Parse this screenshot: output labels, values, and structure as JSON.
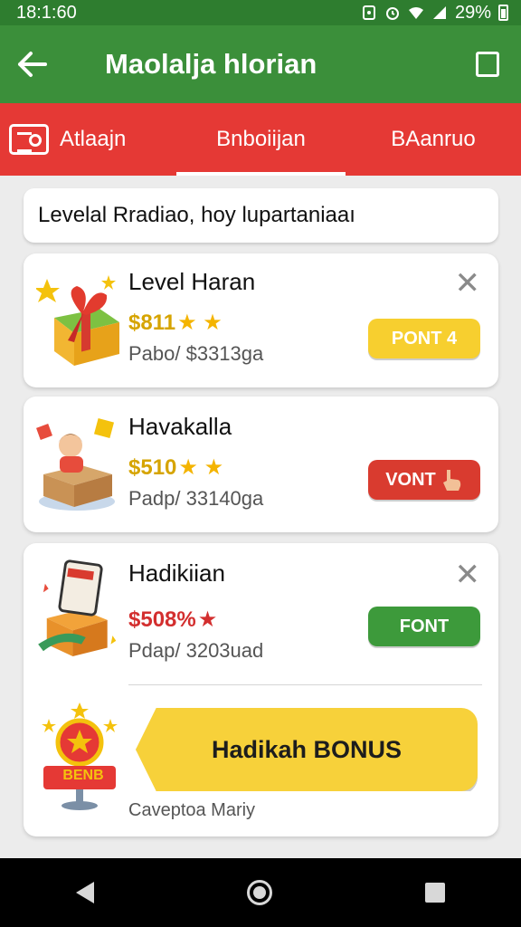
{
  "status_bar": {
    "time": "18:1:60",
    "battery": "29%"
  },
  "app_bar": {
    "title": "Maolalja hlorian",
    "back_icon": "arrow-left-icon",
    "action_icon": "square-icon"
  },
  "tabs": [
    {
      "label": "Atlaajn",
      "icon": "grid-icon",
      "active": false
    },
    {
      "label": "Bnboiijan",
      "active": true
    },
    {
      "label": "BAanruo",
      "active": false
    }
  ],
  "banner": {
    "text": "Levelal  Rradiao, hoy lupartaniaaı"
  },
  "cards": [
    {
      "title": "Level Haran",
      "price": "$811",
      "price_color": "#d6a400",
      "stars": "★ ★",
      "sub": "Pabo/ $3313ga",
      "button": "PONT 4",
      "button_color": "yellow",
      "icon": "gift-box-icon"
    },
    {
      "title": "Havakalla",
      "price": "$510",
      "price_color": "#d6a400",
      "stars": "★ ★",
      "sub": "Padp/ 33140ga",
      "button": "VONT",
      "button_color": "red",
      "icon": "person-box-icon"
    },
    {
      "title": "Hadikiian",
      "price": "$508%",
      "price_color": "#d32f2f",
      "stars": "★",
      "sub": "Pdap/ 3203uad",
      "button": "FONT",
      "button_color": "green",
      "icon": "phone-gift-icon"
    }
  ],
  "bonus": {
    "label": "Hadikah BONUS",
    "sign_text": "BENB",
    "footer": "Caveptoa Mariy"
  },
  "colors": {
    "status_bar": "#2e7d2f",
    "app_bar": "#3b8f3a",
    "tab_bar": "#e53935",
    "yellow": "#f7cf2f",
    "red": "#d93b2f",
    "green": "#3d9a3b"
  }
}
